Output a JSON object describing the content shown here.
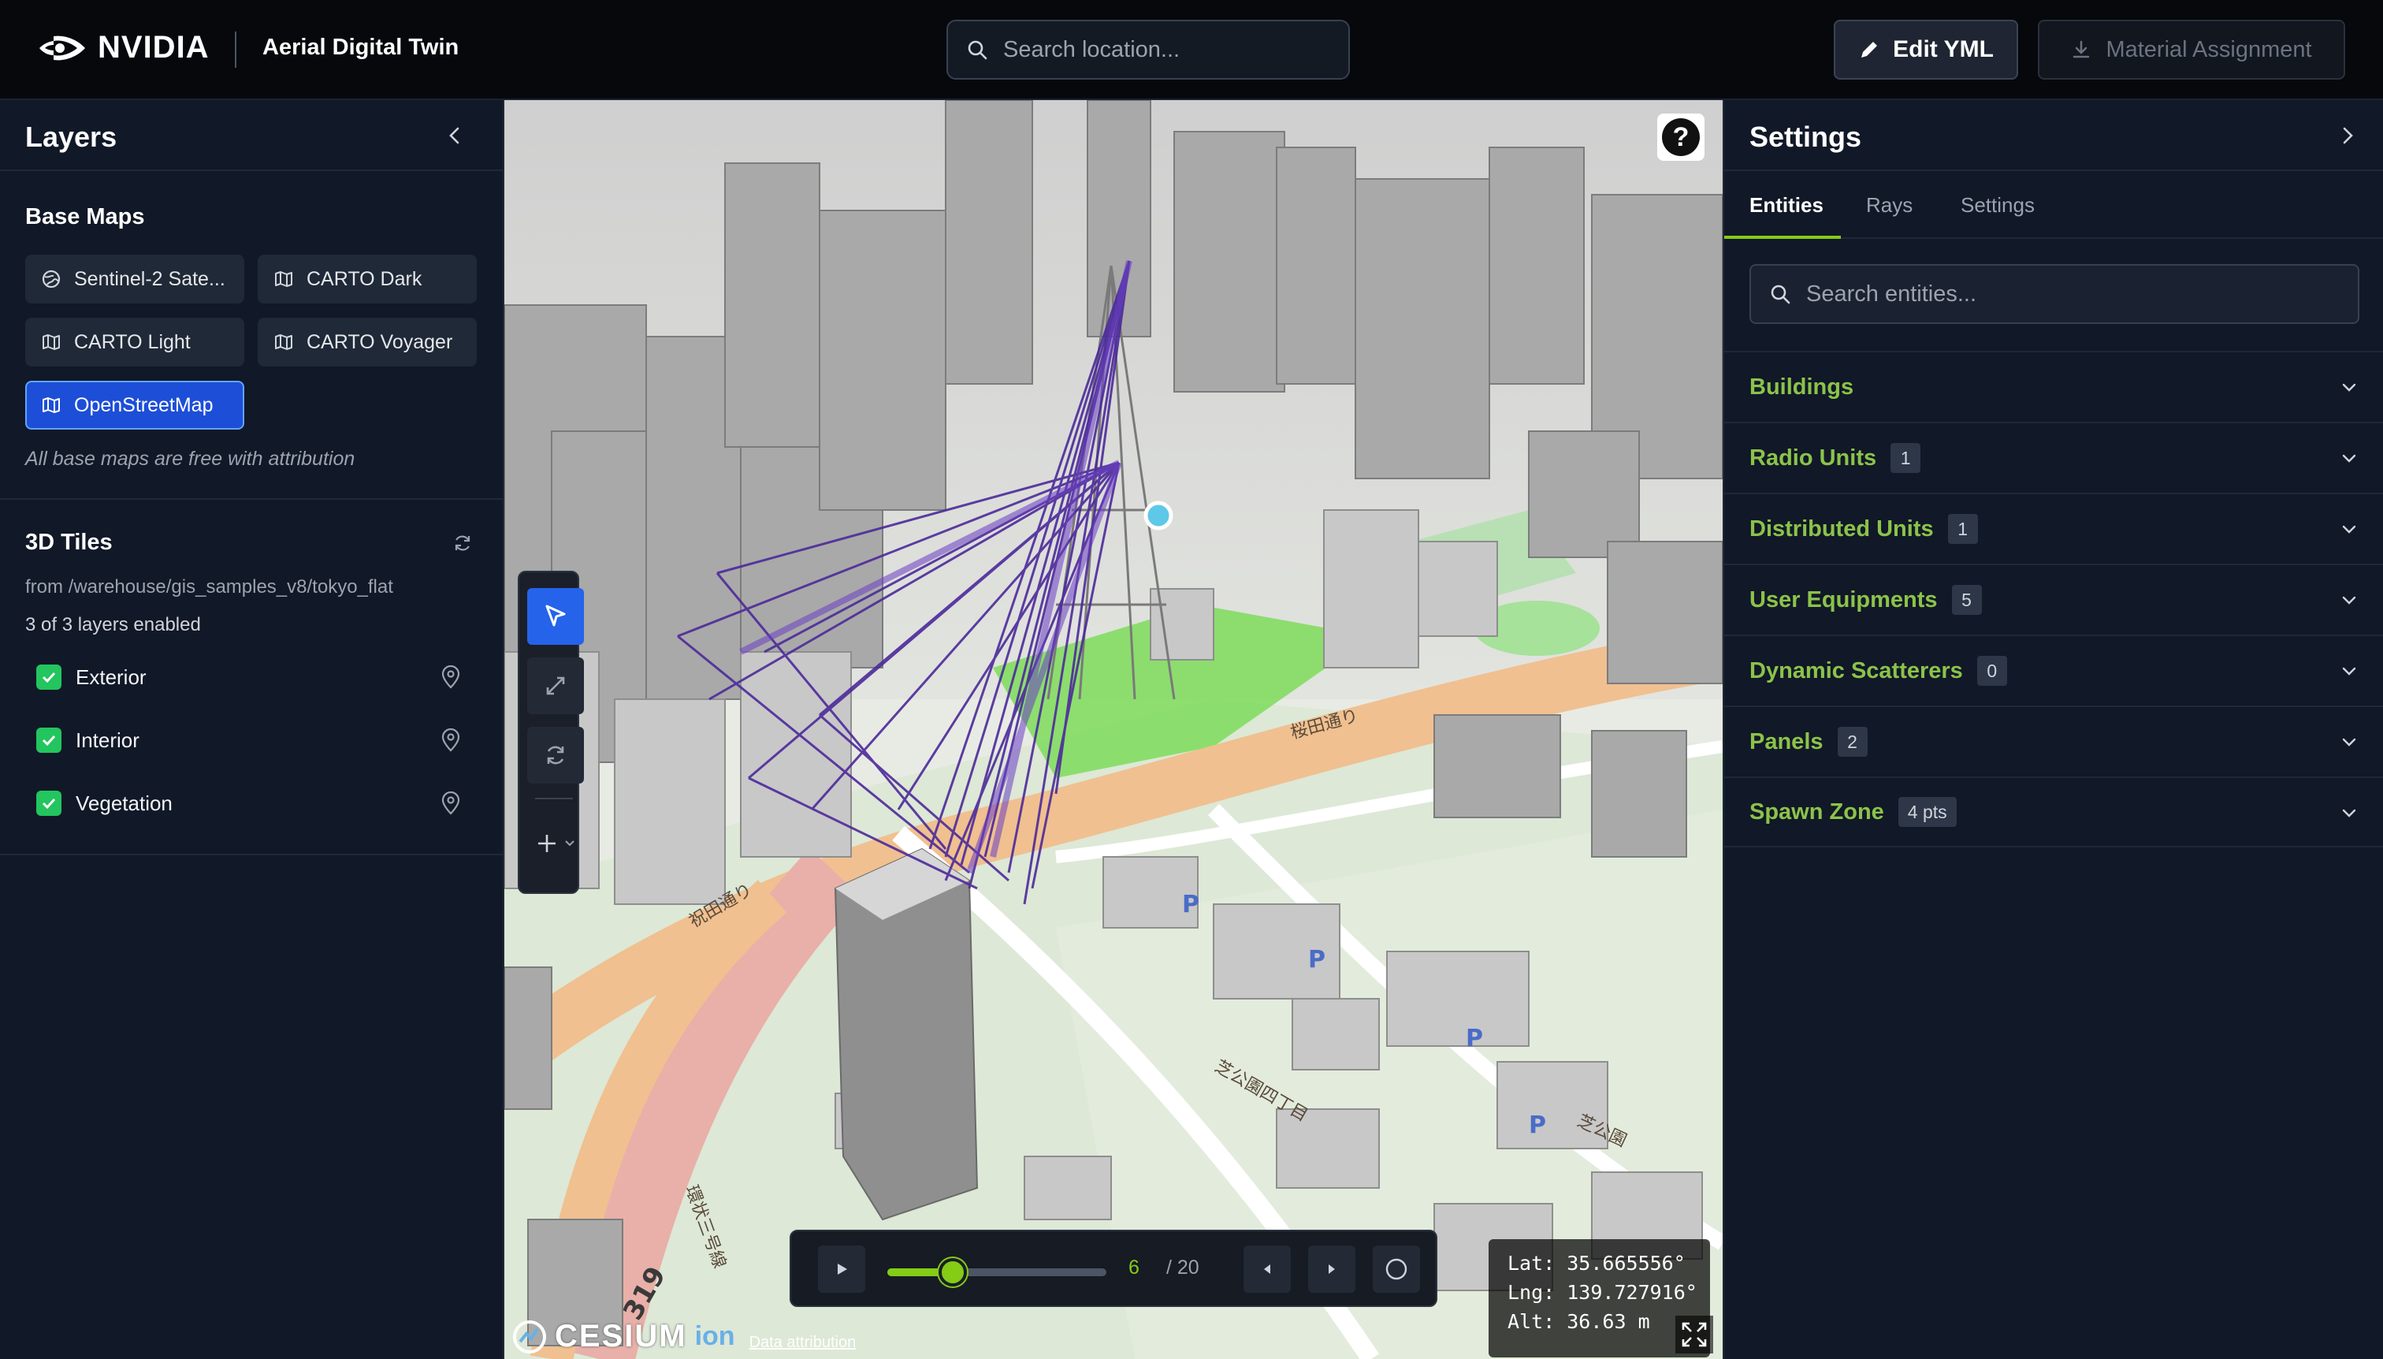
{
  "header": {
    "brand": "NVIDIA",
    "app_title": "Aerial Digital Twin",
    "search_placeholder": "Search location...",
    "edit_label": "Edit YML",
    "material_label": "Material Assignment"
  },
  "layers_panel": {
    "title": "Layers",
    "base_maps_title": "Base Maps",
    "base_maps": [
      {
        "label": "Sentinel-2 Sate...",
        "icon": "globe-icon",
        "active": false
      },
      {
        "label": "CARTO Dark",
        "icon": "map-icon",
        "active": false
      },
      {
        "label": "CARTO Light",
        "icon": "map-icon",
        "active": false
      },
      {
        "label": "CARTO Voyager",
        "icon": "map-icon",
        "active": false
      },
      {
        "label": "OpenStreetMap",
        "icon": "map-icon",
        "active": true
      }
    ],
    "base_maps_note": "All base maps are free with attribution",
    "tiles_title": "3D Tiles",
    "tiles_source": "from /warehouse/gis_samples_v8/tokyo_flat",
    "tiles_count": "3 of 3 layers enabled",
    "tile_layers": [
      {
        "label": "Exterior",
        "checked": true
      },
      {
        "label": "Interior",
        "checked": true
      },
      {
        "label": "Vegetation",
        "checked": true
      }
    ]
  },
  "map": {
    "help_label": "?",
    "tools": [
      "select-tool",
      "resize-tool",
      "rotate-tool",
      "add-tool"
    ],
    "playback": {
      "current_frame": "6",
      "total_frames": "/ 20",
      "progress": 0.3
    },
    "coords": {
      "lat": "Lat: 35.665556°",
      "lng": "Lng: 139.727916°",
      "alt": "Alt: 36.63 m"
    },
    "attribution": {
      "logo": "CESIUM",
      "logo_suffix": "ion",
      "link": "Data attribution"
    },
    "colors": {
      "rays": "#4c2a9a",
      "ray_anchor": "#5ec8e8",
      "park": "#7ddc5a",
      "road": "#f0c090"
    }
  },
  "settings_panel": {
    "title": "Settings",
    "tabs": [
      {
        "label": "Entities",
        "active": true
      },
      {
        "label": "Rays",
        "active": false
      },
      {
        "label": "Settings",
        "active": false
      }
    ],
    "search_placeholder": "Search entities...",
    "categories": [
      {
        "name": "Buildings",
        "count": ""
      },
      {
        "name": "Radio Units",
        "count": "1"
      },
      {
        "name": "Distributed Units",
        "count": "1"
      },
      {
        "name": "User Equipments",
        "count": "5"
      },
      {
        "name": "Dynamic Scatterers",
        "count": "0"
      },
      {
        "name": "Panels",
        "count": "2"
      },
      {
        "name": "Spawn Zone",
        "count": "4 pts"
      }
    ]
  },
  "colors": {
    "accent_green": "#84cc16",
    "category_green": "#8bc34a",
    "active_blue": "#2563eb"
  }
}
